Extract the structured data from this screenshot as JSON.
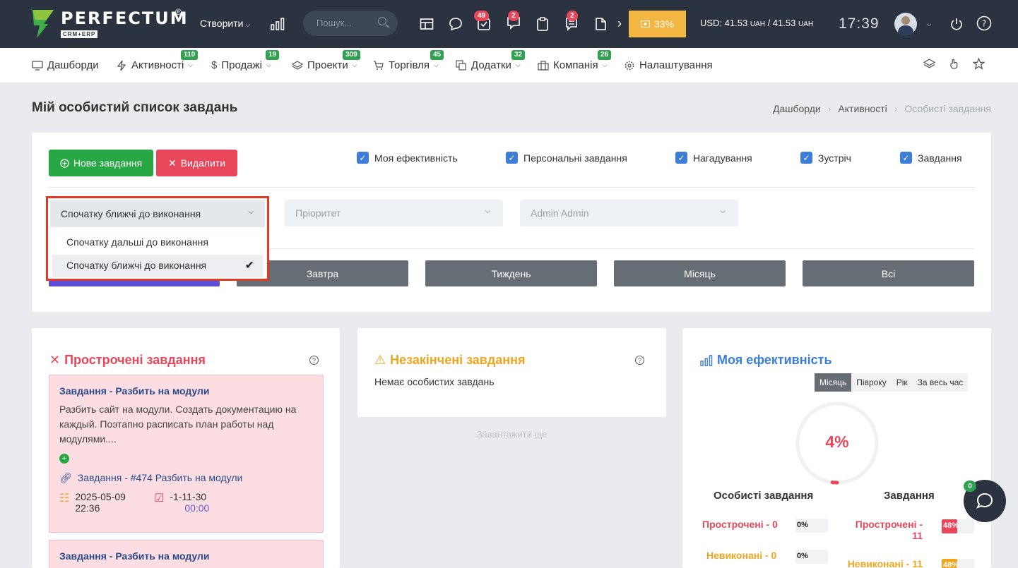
{
  "topbar": {
    "logo_title": "PERFECTUM",
    "logo_sub": "CRM+ERP",
    "logo_reg": "®",
    "create_label": "Створити",
    "search_placeholder": "Пошук...",
    "badges": {
      "tasks": "49",
      "chat": "2",
      "notes": "2"
    },
    "promo_label": "33%",
    "currency_text": "USD: 41.53",
    "currency_unit": "UAH",
    "currency_text2": "/ 41.53",
    "clock": "17:39",
    "more_arrow": "›"
  },
  "nav": {
    "items": [
      {
        "label": "Дашборди",
        "badge": ""
      },
      {
        "label": "Активності",
        "badge": "110"
      },
      {
        "label": "Продажі",
        "badge": "19"
      },
      {
        "label": "Проекти",
        "badge": "309"
      },
      {
        "label": "Торгівля",
        "badge": "45"
      },
      {
        "label": "Додатки",
        "badge": "32"
      },
      {
        "label": "Компанія",
        "badge": "26"
      },
      {
        "label": "Налаштування",
        "badge": ""
      }
    ]
  },
  "page": {
    "title": "Мій особистий список завдань",
    "breadcrumb": [
      "Дашборди",
      "Активності",
      "Особисті завдання"
    ]
  },
  "filters": {
    "new_task": "Нове завдання",
    "delete": "Видалити",
    "checkboxes": [
      "Моя ефективність",
      "Персональні завдання",
      "Нагадування",
      "Зустріч",
      "Завдання"
    ],
    "sort_selected": "Спочатку ближчі до виконання",
    "sort_options": [
      "Спочатку дальші до виконання",
      "Спочатку ближчі до виконання"
    ],
    "priority_placeholder": "Пріоритет",
    "assignee": "Admin Admin",
    "periods": [
      "Завтра",
      "Тиждень",
      "Місяць",
      "Всі"
    ]
  },
  "overdue": {
    "title": "Прострочені завдання",
    "tasks": [
      {
        "title": "Завдання - Разбить на модули",
        "desc": "Разбить сайт на модули. Создать документацию на каждый. Поэтапно расписать план работы над модулями....",
        "link": "Завдання - #474 Разбить на модули",
        "start_date": "2025-05-09",
        "start_time": "22:36",
        "due": "-1-11-30",
        "due_time": "00:00"
      },
      {
        "title": "Завдання - Разбить на модули"
      }
    ]
  },
  "unfinished": {
    "title": "Незакінчені завдання",
    "empty": "Немає особистих завдань",
    "load_more": "Завантажити ще"
  },
  "efficiency": {
    "title": "Моя ефективність",
    "tabs": [
      "Місяць",
      "Півроку",
      "Рік",
      "За весь час"
    ],
    "active_tab": "Місяць",
    "gauge_value": 4,
    "gauge_label": "4%",
    "col_personal": "Особисті завдання",
    "col_tasks": "Завдання",
    "personal": [
      {
        "label": "Прострочені - 0",
        "pct": 0,
        "pct_label": "0%",
        "color": "#e8475b"
      },
      {
        "label": "Невиконані - 0",
        "pct": 0,
        "pct_label": "0%",
        "color": "#f0a51f"
      }
    ],
    "tasks": [
      {
        "label": "Прострочені - 11",
        "pct": 48,
        "pct_label": "48%",
        "color": "#e8475b"
      },
      {
        "label": "Невиконані - 11",
        "pct": 48,
        "pct_label": "48%",
        "color": "#f0a51f"
      }
    ]
  },
  "chat": {
    "badge": "0"
  }
}
